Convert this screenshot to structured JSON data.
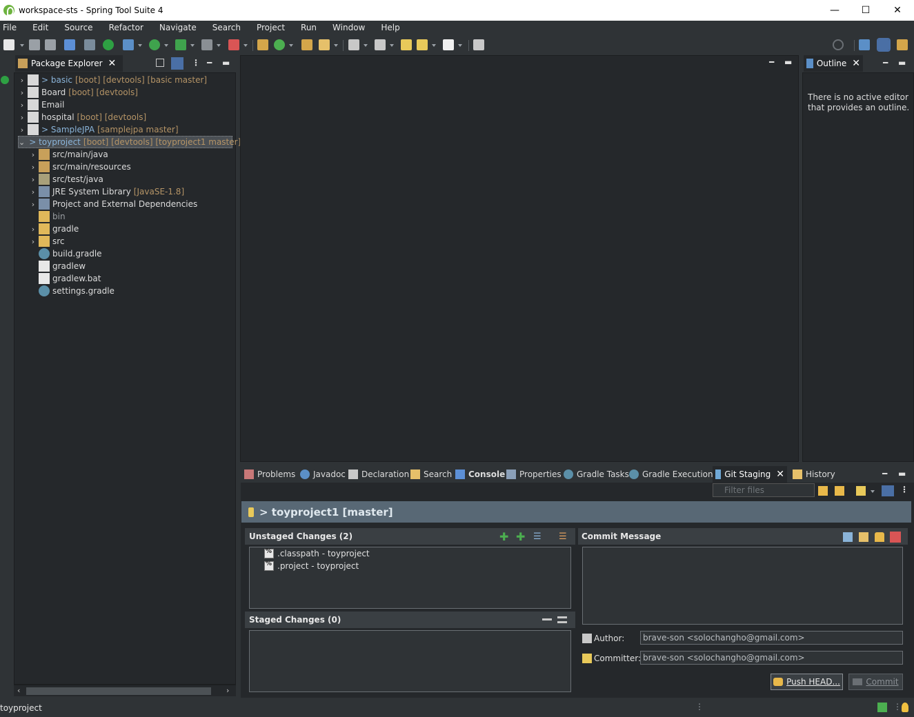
{
  "window": {
    "title": "workspace-sts - Spring Tool Suite 4",
    "minimize": "—",
    "maximize": "☐",
    "close": "✕"
  },
  "menu": [
    "File",
    "Edit",
    "Source",
    "Refactor",
    "Navigate",
    "Search",
    "Project",
    "Run",
    "Window",
    "Help"
  ],
  "package_explorer": {
    "tab_label": "Package Explorer",
    "tree": [
      {
        "arrow": "›",
        "git": "> basic",
        "dec": "[boot] [devtools] [basic master]"
      },
      {
        "arrow": "›",
        "label": "Board",
        "dec": "[boot] [devtools]"
      },
      {
        "arrow": "›",
        "label": "Email",
        "dec": ""
      },
      {
        "arrow": "›",
        "label": "hospital",
        "dec": "[boot] [devtools]"
      },
      {
        "arrow": "›",
        "git": "> SampleJPA",
        "dec": "[samplejpa master]"
      },
      {
        "arrow": "⌄",
        "git": "> toyproject",
        "dec": "[boot] [devtools] [toyproject1 master]"
      },
      {
        "arrow": "›",
        "label": "src/main/java",
        "dec": ""
      },
      {
        "arrow": "›",
        "label": "src/main/resources",
        "dec": ""
      },
      {
        "arrow": "›",
        "label": "src/test/java",
        "dec": ""
      },
      {
        "arrow": "›",
        "label": "JRE System Library",
        "dec": "[JavaSE-1.8]"
      },
      {
        "arrow": "›",
        "label": "Project and External Dependencies",
        "dec": ""
      },
      {
        "arrow": "",
        "label": "bin",
        "dec": ""
      },
      {
        "arrow": "›",
        "label": "gradle",
        "dec": ""
      },
      {
        "arrow": "›",
        "label": "src",
        "dec": ""
      },
      {
        "arrow": "",
        "label": "build.gradle",
        "dec": ""
      },
      {
        "arrow": "",
        "label": "gradlew",
        "dec": ""
      },
      {
        "arrow": "",
        "label": "gradlew.bat",
        "dec": ""
      },
      {
        "arrow": "",
        "label": "settings.gradle",
        "dec": ""
      }
    ]
  },
  "outline": {
    "tab_label": "Outline",
    "message": "There is no active editor that provides an outline."
  },
  "bottom_tabs": [
    "Problems",
    "Javadoc",
    "Declaration",
    "Search",
    "Console",
    "Properties",
    "Gradle Tasks",
    "Gradle Executions",
    "Git Staging",
    "History"
  ],
  "git_staging": {
    "filter_placeholder": "Filter files",
    "repo_title": "> toyproject1 [master]",
    "unstaged_title": "Unstaged Changes (2)",
    "unstaged_files": [
      ".classpath - toyproject",
      ".project - toyproject"
    ],
    "staged_title": "Staged Changes (0)",
    "commit_message_title": "Commit Message",
    "author_label": "Author:",
    "author_value": "brave-son <solochangho@gmail.com>",
    "committer_label": "Committer:",
    "committer_value": "brave-son <solochangho@gmail.com>",
    "push_button": "Push HEAD...",
    "commit_button": "Commit"
  },
  "status_bar": {
    "text": "toyproject"
  },
  "colors": {
    "background": "#2f3336",
    "view": "#25282b",
    "header": "#586875",
    "git_label": "#8ab4d9",
    "decoration": "#b59466"
  }
}
